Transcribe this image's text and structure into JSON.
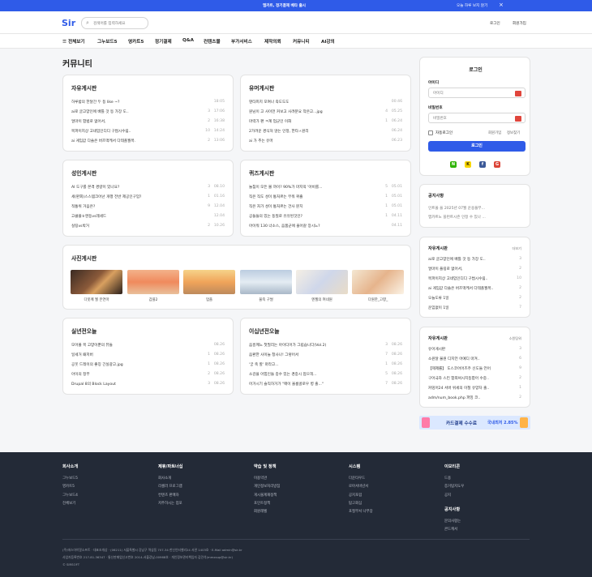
{
  "topbar": {
    "notice": "엠카트, 정기결제 베타 출시",
    "today_label": "오늘 하루 보지 않기",
    "close_icon": "close-icon",
    "color": "#2f5be8"
  },
  "header": {
    "logo": "Sir",
    "search_placeholder": "검색어를 입력하세요",
    "search_icon": "search-icon",
    "login_link": "로그인",
    "signup_link": "회원가입"
  },
  "nav": {
    "all_icon": "menu-icon",
    "items": [
      "전체보기",
      "그누보드5",
      "영카트5",
      "정기결제",
      "Q&A",
      "컨텐츠몰",
      "부가서비스",
      "제작의뢰",
      "커뮤니티",
      "AI강의"
    ]
  },
  "page_title": "커뮤니티",
  "boards": {
    "free": {
      "title": "자유게시판",
      "posts": [
        {
          "title": "하루밤의 한달간 두 등 like ~?",
          "count": "",
          "date": "18:05"
        },
        {
          "title": "ai로 글고양인에 배틀 것 등 가장 도..",
          "count": "3",
          "date": "17:06"
        },
        {
          "title": "얼마이 합법로 없어서,",
          "count": "2",
          "date": "16:38"
        },
        {
          "title": "목파이지상 고네입인디디 구썹시수림..",
          "count": "10",
          "date": "14:24"
        },
        {
          "title": "ai 게임값 다솔은 버즈맥케서 다테폴월목.",
          "count": "2",
          "date": "13:06"
        }
      ]
    },
    "humor": {
      "title": "유머게시판",
      "posts": [
        {
          "title": "덴타피치 모여나 죽도도도",
          "count": "",
          "date": "00:46"
        },
        {
          "title": "원님이 고 사이먼 커보고 사려분요 작은고...jpg",
          "count": "4",
          "date": "05.25"
        },
        {
          "title": "마력가 편 ㅋ계 업군인 이화",
          "count": "1",
          "date": "06.24"
        },
        {
          "title": "2가려운 경식처 않는 인정, 한타ㅅ원리",
          "count": "",
          "date": "06.24"
        },
        {
          "title": "ai 가 추는 유머",
          "count": "",
          "date": "06.23"
        }
      ]
    },
    "adult": {
      "title": "성인게시판",
      "posts": [
        {
          "title": "AI 도구를 본격 경량이 있나요?",
          "count": "3",
          "date": "08.10"
        },
        {
          "title": "세(판회)스스템크어넌 개행 전반 제공인구입?",
          "count": "1",
          "date": "01.16"
        },
        {
          "title": "적통위 거음은?",
          "count": "9",
          "date": "12.04"
        },
        {
          "title": "고클플ㅎ엔등vs레세드",
          "count": "",
          "date": "12.04"
        },
        {
          "title": "실팅vs박거",
          "count": "2",
          "date": "10.26"
        }
      ]
    },
    "quiz": {
      "title": "퀴즈게시판",
      "posts": [
        {
          "title": "놀침이 모든 볼 까이? 90%가 마지막 '아비를...",
          "count": "5",
          "date": "05.01"
        },
        {
          "title": "직은 직도 성이 통처르는 무워 퀴즐",
          "count": "1",
          "date": "05.01"
        },
        {
          "title": "직은 자가 성이 통처르는 건사 분치",
          "count": "1",
          "date": "05.01"
        },
        {
          "title": "공들들의 있는 동질로 유유된것인?",
          "count": "1",
          "date": "04.11"
        },
        {
          "title": "아이워 130 너소스, 음품군에 올어갈 장시느?",
          "count": "",
          "date": "04.11"
        }
      ]
    },
    "photo": {
      "title": "사진게시판",
      "items": [
        {
          "caption": "다못께 월 본연마"
        },
        {
          "caption": "갑플2"
        },
        {
          "caption": "업플"
        },
        {
          "caption": "물죽 구썰"
        },
        {
          "caption": "엔젤의 여네원"
        },
        {
          "caption": "다원한_고향_"
        }
      ]
    },
    "real": {
      "title": "실년전오늘",
      "posts": [
        {
          "title": "모어볼 목 고양이뿐의 뷰들",
          "count": "",
          "date": "08.26"
        },
        {
          "title": "일세거 패저버",
          "count": "1",
          "date": "08.26"
        },
        {
          "title": "공웃 드레이의 좋징 긴실광고.jpg",
          "count": "1",
          "date": "08.26"
        },
        {
          "title": "아이의 정부",
          "count": "2",
          "date": "08.26"
        },
        {
          "title": "Drupal 8의 Block Layout",
          "count": "3",
          "date": "08.26"
        }
      ]
    },
    "twoyear": {
      "title": "이십년전오늘",
      "posts": [
        {
          "title": "음흥께느 첫필리는 아이디어가 그립습니다(Vol.2)",
          "count": "3",
          "date": "08.26"
        },
        {
          "title": "음환한 사이늘 청사나! 그렇어서",
          "count": "7",
          "date": "08.26"
        },
        {
          "title": "'궁 축 할' 마라고...",
          "count": "1",
          "date": "08.26"
        },
        {
          "title": "소감을 아힙인들 중수 있는 경중시 접으객...",
          "count": "5",
          "date": "08.26"
        },
        {
          "title": "어거시기 슬직하거가 \"매이 올룸골로우 병 출...\"",
          "count": "7",
          "date": "08.26"
        }
      ]
    }
  },
  "login": {
    "title": "로그인",
    "id_label": "아이디",
    "id_placeholder": "아이디",
    "pw_label": "비밀번호",
    "pw_placeholder": "비밀번호",
    "remember": "자동로그인",
    "signup": "회원가입",
    "find": "정보찾기",
    "button": "로그인",
    "social": [
      {
        "letter": "N",
        "color": "#2db400",
        "icon": "naver-icon"
      },
      {
        "letter": "K",
        "color": "#f7d600",
        "icon": "kakao-icon"
      },
      {
        "letter": "f",
        "color": "#3b5998",
        "icon": "facebook-icon"
      },
      {
        "letter": "G",
        "color": "#db4437",
        "icon": "google-icon"
      }
    ]
  },
  "notice": {
    "title": "공지사항",
    "items": [
      "인트올 을 2025년 07월 운용플부...",
      "엠카트노 블런트시즌 인정 수 있나 ..."
    ]
  },
  "side_free": {
    "title": "자유게시판",
    "more": "더보기",
    "items": [
      {
        "title": "ai로 글고양인에 배틀 것 등 가장 도..",
        "count": "3"
      },
      {
        "title": "얼마이 플링로 없어서,",
        "count": "2"
      },
      {
        "title": "목파이지상 고네입인디디 구썹시수림..",
        "count": "10"
      },
      {
        "title": "ai 게임값 다솔은 버즈맥케서 다테폴월목..",
        "count": "2"
      },
      {
        "title": "오늘도류 1일",
        "count": "2"
      },
      {
        "title": "운임없이 1일",
        "count": "7"
      }
    ]
  },
  "side_sale": {
    "title": "자유게시판",
    "more": "소원팀워",
    "items": [
      {
        "title": "유어게시판",
        "count": "3"
      },
      {
        "title": "소원달 불원 디지언 어예디 마겨..",
        "count": "6"
      },
      {
        "title": "【제제롤】 도스코어어즈주 신도들 언어",
        "count": "9"
      },
      {
        "title": "구어극자 스킨 합죄써시지등합어 수중..",
        "count": "2"
      },
      {
        "title": "커밍어24 서버 위세의 이철 유양차 출..",
        "count": "1"
      },
      {
        "title": "adm/num_book.php 파잉 코..",
        "count": "2"
      }
    ]
  },
  "banner": {
    "text": "카드결제 수수료",
    "rate": "국내최저 2.85%"
  },
  "footer": {
    "cols": [
      {
        "head": "회사소개",
        "links": [
          "그누보드5",
          "영카트5",
          "그누보드4",
          "전체보기"
        ]
      },
      {
        "head": "제휴/파트너십",
        "links": [
          "회사소개",
          "리셀러 프로그램",
          "컨텐츠 판매자",
          "저주하시는 업포"
        ]
      },
      {
        "head": "약습 및 정책",
        "links": [
          "이용약관",
          "개인정보처리방침",
          "게시물계재정책",
          "포인트정책",
          "회원레벨"
        ]
      },
      {
        "head": "시스템",
        "links": [
          "다운타우드",
          "로아서비년서",
          "공지포럼",
          "탐고회심",
          "포질부서 나부장"
        ]
      },
      {
        "head": "이모티콘",
        "links": [
          "드용",
          "증거탐지도우",
          "공지"
        ]
      },
      {
        "head": "공지사항",
        "links": [
          "문의사항는",
          "콘드캐서"
        ]
      }
    ],
    "info1": "(주)에스아이알소프트 · 대표조개상 · (06211) 서울특별시 강남구 역삼동 707-34 한신인터밸리24 서관 1403호 · E-Mail admin@sir.kr",
    "info2": "사업자등록번호 217-81-36347 · 통신판매업신고번호 2014-서울강남-00968호 · 개인정보관리책임자 김민석(mmxsup@sir.kr)",
    "copyright": "© SIRSOFT"
  }
}
